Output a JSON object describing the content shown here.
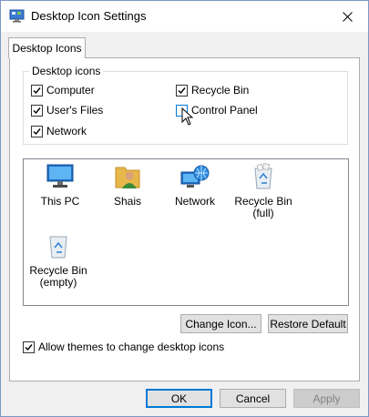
{
  "window": {
    "title": "Desktop Icon Settings"
  },
  "tabs": [
    {
      "label": "Desktop Icons"
    }
  ],
  "group": {
    "legend": "Desktop icons",
    "checkboxes": [
      {
        "label": "Computer",
        "checked": true
      },
      {
        "label": "Recycle Bin",
        "checked": true
      },
      {
        "label": "User's Files",
        "checked": true
      },
      {
        "label": "Control Panel",
        "checked": false
      },
      {
        "label": "Network",
        "checked": true
      }
    ]
  },
  "icons": [
    {
      "label": "This PC",
      "icon": "computer-icon"
    },
    {
      "label": "Shais",
      "icon": "user-folder-icon"
    },
    {
      "label": "Network",
      "icon": "network-icon"
    },
    {
      "label": "Recycle Bin\n(full)",
      "icon": "recycle-bin-full-icon"
    },
    {
      "label": "Recycle Bin\n(empty)",
      "icon": "recycle-bin-empty-icon"
    }
  ],
  "buttons": {
    "change_icon": "Change Icon...",
    "restore_default": "Restore Default",
    "ok": "OK",
    "cancel": "Cancel",
    "apply": "Apply"
  },
  "allow_themes": {
    "label": "Allow themes to change desktop icons",
    "checked": true
  },
  "colors": {
    "accent": "#0078d7",
    "panel": "#ffffff",
    "dialog_bg": "#f0f0f0"
  }
}
